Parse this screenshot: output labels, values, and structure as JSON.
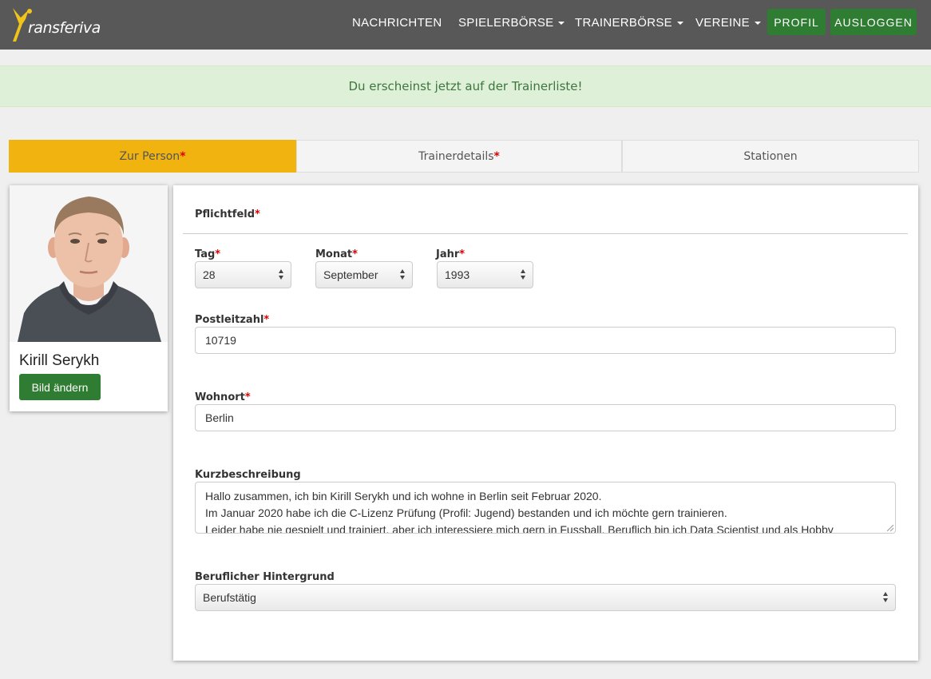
{
  "nav": {
    "logo_text": "ransferiva",
    "links": [
      "NACHRICHTEN",
      "SPIELERBÖRSE",
      "TRAINERBÖRSE",
      "VEREINE"
    ],
    "profile_btn": "PROFIL",
    "logout_btn": "AUSLOGGEN"
  },
  "alert": {
    "message": "Du erscheinst jetzt auf der Trainerliste!"
  },
  "tabs": [
    {
      "label": "Zur Person",
      "required": "*"
    },
    {
      "label": "Trainerdetails",
      "required": "*"
    },
    {
      "label": "Stationen"
    }
  ],
  "profile": {
    "name": "Kirill Serykh",
    "change_photo_btn": "Bild ändern"
  },
  "form": {
    "section_title": "Pflichtfeld",
    "required_mark": "*",
    "day": {
      "label": "Tag",
      "value": "28"
    },
    "month": {
      "label": "Monat",
      "value": "September"
    },
    "year": {
      "label": "Jahr",
      "value": "1993"
    },
    "postal_code": {
      "label": "Postleitzahl",
      "value": "10719"
    },
    "city": {
      "label": "Wohnort",
      "value": "Berlin"
    },
    "description": {
      "label": "Kurzbeschreibung",
      "lines": [
        "Hallo zusammen, ich bin Kirill Serykh und ich wohne in Berlin seit Februar 2020.",
        "Im Januar 2020 habe ich die C-Lizenz Prüfung (Profil: Jugend) bestanden und ich möchte gern trainieren.",
        "Leider habe nie gespielt und trainiert, aber ich interessiere mich gern in Fussball. Beruflich bin ich Data Scientist und als Hobby"
      ]
    },
    "background": {
      "label": "Beruflicher Hintergrund",
      "value": "Berufstätig"
    }
  },
  "colors": {
    "navbar": "#585858",
    "accent_green": "#2f7d33",
    "tab_active": "#f0b310",
    "alert_bg": "#dff0d8",
    "alert_text": "#3c763d",
    "required": "#dd0000"
  }
}
